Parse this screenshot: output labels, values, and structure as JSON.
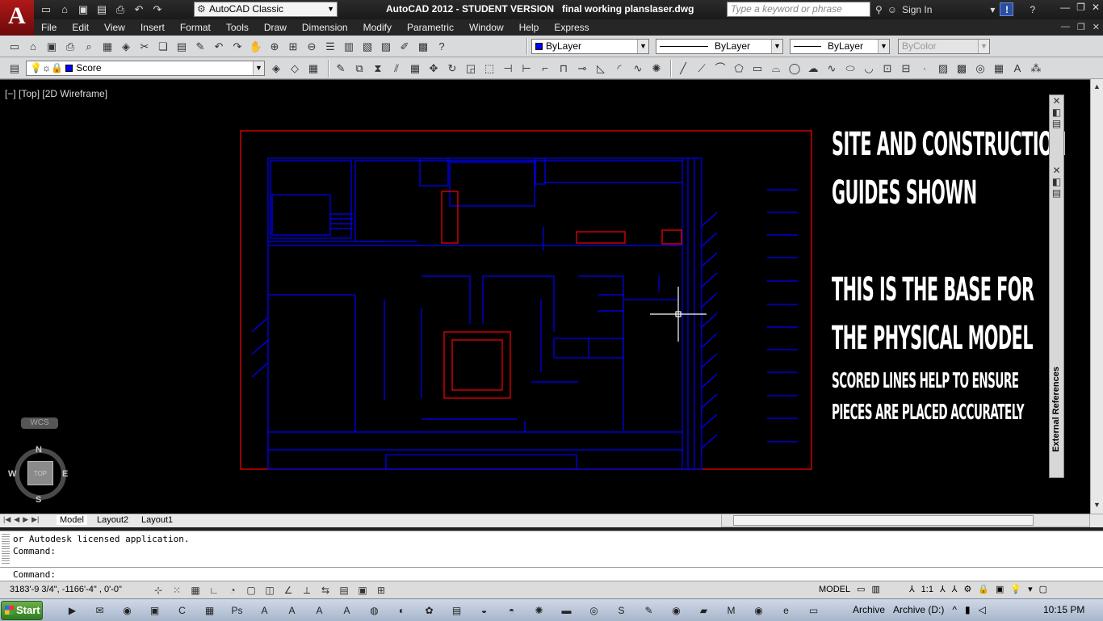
{
  "titlebar": {
    "workspace": "AutoCAD Classic",
    "title": "AutoCAD 2012 - STUDENT VERSION   final working planslaser.dwg",
    "search_placeholder": "Type a keyword or phrase",
    "signin": "Sign In"
  },
  "menu": [
    "File",
    "Edit",
    "View",
    "Insert",
    "Format",
    "Tools",
    "Draw",
    "Dimension",
    "Modify",
    "Parametric",
    "Window",
    "Help",
    "Express"
  ],
  "toolbar": {
    "color": "ByLayer",
    "linetype": "ByLayer",
    "lineweight": "ByLayer",
    "plotstyle": "ByColor",
    "layer": "Score"
  },
  "viewport": {
    "label": "[−] [Top] [2D Wireframe]",
    "wcs": "WCS",
    "cube_top": "TOP",
    "compass": {
      "n": "N",
      "s": "S",
      "e": "E",
      "w": "W"
    }
  },
  "notes": {
    "line1": "SITE AND CONSTRUCTION",
    "line2": "GUIDES SHOWN",
    "line3": "THIS IS THE BASE FOR",
    "line4": "THE PHYSICAL MODEL",
    "line5": "SCORED LINES HELP TO ENSURE",
    "line6": "PIECES ARE PLACED ACCURATELY"
  },
  "palette": {
    "label": "External References"
  },
  "tabs": [
    "Model",
    "Layout2",
    "Layout1"
  ],
  "command": {
    "history1": "or Autodesk licensed application.",
    "history2": "Command:",
    "prompt": "Command:"
  },
  "status": {
    "coords": "3183'-9 3/4\", -1166'-4\" , 0'-0\"",
    "model": "MODEL",
    "scale": "1:1"
  },
  "taskbar": {
    "start": "Start",
    "archive": "Archive",
    "archive_drive": "Archive (D:)",
    "time": "10:15 PM"
  },
  "colors": {
    "drawing_blue": "#0000ff",
    "drawing_red": "#ff0000",
    "canvas": "#000000"
  }
}
